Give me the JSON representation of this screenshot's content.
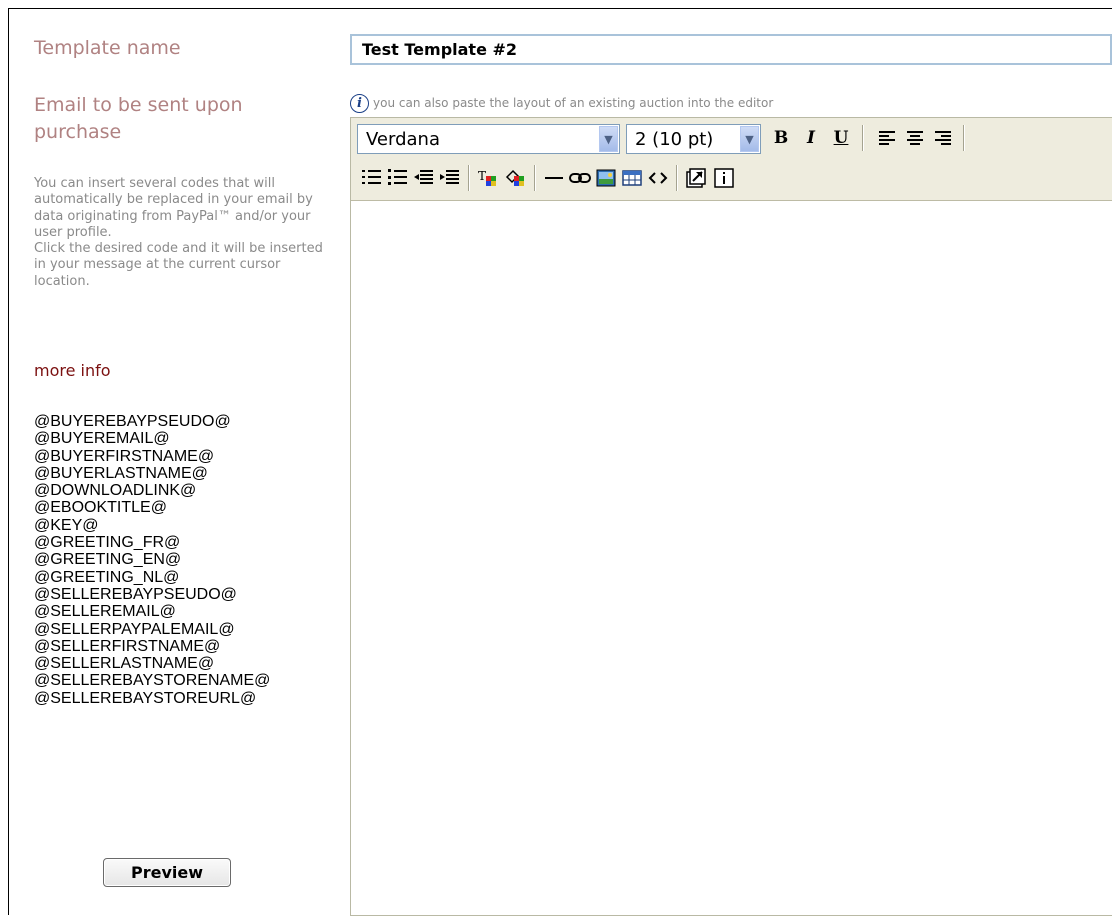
{
  "labels": {
    "template_name": "Template name",
    "email_label": "Email to be sent upon purchase",
    "help_text_1": "You can insert several codes that will automatically be replaced in your email by data originating from PayPal™ and/or your user profile.",
    "help_text_2": "Click the desired code and it will be inserted in your message at the current cursor location.",
    "more_info": "more info"
  },
  "codes": [
    "@BUYEREBAYPSEUDO@",
    "@BUYEREMAIL@",
    "@BUYERFIRSTNAME@",
    "@BUYERLASTNAME@",
    "@DOWNLOADLINK@",
    "@EBOOKTITLE@",
    "@KEY@",
    "@GREETING_FR@",
    "@GREETING_EN@",
    "@GREETING_NL@",
    "@SELLEREBAYPSEUDO@",
    "@SELLEREMAIL@",
    "@SELLERPAYPALEMAIL@",
    "@SELLERFIRSTNAME@",
    "@SELLERLASTNAME@",
    "@SELLEREBAYSTORENAME@",
    "@SELLEREBAYSTOREURL@"
  ],
  "preview_button": "Preview",
  "template_name_value": "Test Template #2",
  "info_text": "you can also paste the layout of an existing auction into the editor",
  "toolbar": {
    "font_value": "Verdana",
    "size_value": "2 (10 pt)",
    "bold": "B",
    "italic": "I",
    "underline": "U",
    "icons": [
      "align-left-icon",
      "align-center-icon",
      "align-right-icon",
      "ordered-list-icon",
      "unordered-list-icon",
      "outdent-icon",
      "indent-icon",
      "text-color-icon",
      "background-color-icon",
      "horizontal-rule-icon",
      "link-icon",
      "image-icon",
      "table-icon",
      "html-source-icon",
      "popup-window-icon",
      "about-icon"
    ]
  },
  "colors": {
    "label": "#b08282",
    "help": "#8a8a8a",
    "link": "#7b1010",
    "toolbar_bg": "#eeecde",
    "input_border": "#a9c3da"
  }
}
